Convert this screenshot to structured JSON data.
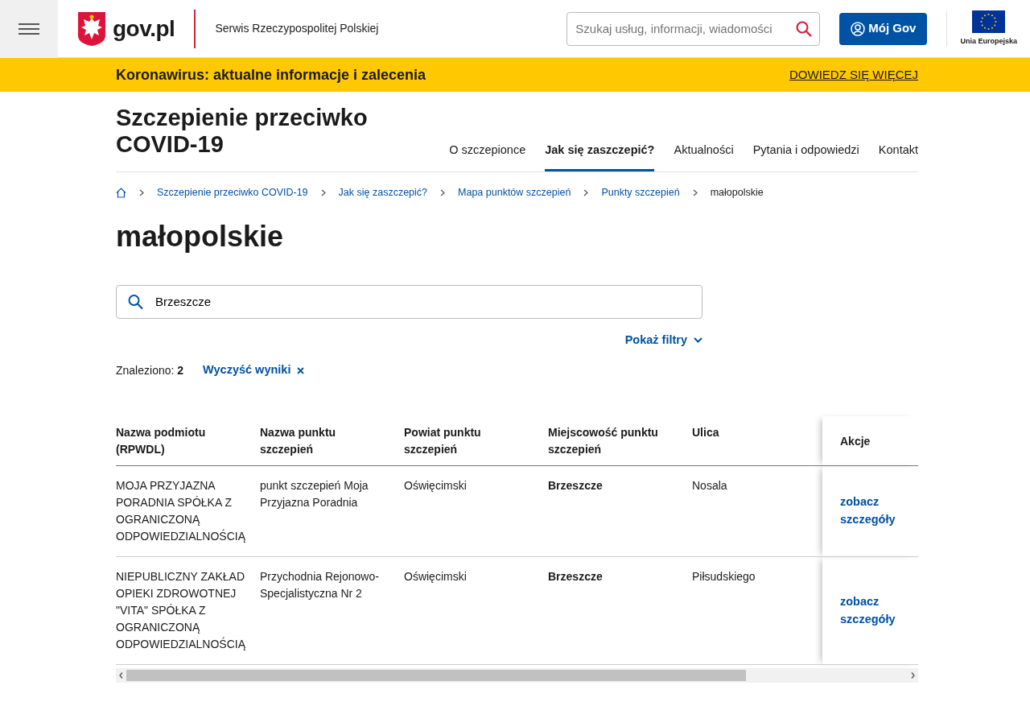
{
  "header": {
    "logo_text": "gov.pl",
    "service_name": "Serwis Rzeczypospolitej Polskiej",
    "search": {
      "placeholder": "Szukaj usług, informacji, wiadomości"
    },
    "account_button": "Mój Gov",
    "eu_label": "Unia Europejska"
  },
  "alert_bar": {
    "text": "Koronawirus: aktualne informacje i zalecenia",
    "link": "DOWIEDZ SIĘ WIĘCEJ"
  },
  "site": {
    "title": "Szczepienie przeciwko COVID-19",
    "nav": [
      {
        "label": "O szczepionce",
        "selected": false
      },
      {
        "label": "Jak się zaszczepić?",
        "selected": true
      },
      {
        "label": "Aktualności",
        "selected": false
      },
      {
        "label": "Pytania i odpowiedzi",
        "selected": false
      },
      {
        "label": "Kontakt",
        "selected": false
      }
    ]
  },
  "breadcrumbs": [
    "Szczepienie przeciwko COVID-19",
    "Jak się zaszczepić?",
    "Mapa punktów szczepień",
    "Punkty szczepień",
    "małopolskie"
  ],
  "page_title": "małopolskie",
  "search": {
    "value": "Brzeszcze"
  },
  "filters_toggle": "Pokaż filtry",
  "results": {
    "label": "Znaleziono:",
    "count": "2",
    "clear": "Wyczyść wyniki"
  },
  "table": {
    "columns": [
      "Nazwa podmiotu (RPWDL)",
      "Nazwa punktu szczepień",
      "Powiat punktu szczepień",
      "Miejscowość punktu szczepień",
      "Ulica",
      "Akcje"
    ],
    "rows": [
      {
        "cells": [
          "MOJA PRZYJAZNA PORADNIA SPÓŁKA Z OGRANICZONĄ ODPOWIEDZIALNOŚCIĄ",
          "punkt szczepień Moja Przyjazna Poradnia",
          "Oświęcimski",
          "Brzeszcze",
          "Nosala"
        ],
        "action": "zobacz szczegóły"
      },
      {
        "cells": [
          "NIEPUBLICZNY ZAKŁAD OPIEKI ZDROWOTNEJ \"VITA\" SPÓŁKA Z OGRANICZONĄ ODPOWIEDZIALNOŚCIĄ",
          "Przychodnia Rejonowo-Specjalistyczna Nr 2",
          "Oświęcimski",
          "Brzeszcze",
          "Piłsudskiego"
        ],
        "action": "zobacz szczegóły"
      }
    ]
  }
}
